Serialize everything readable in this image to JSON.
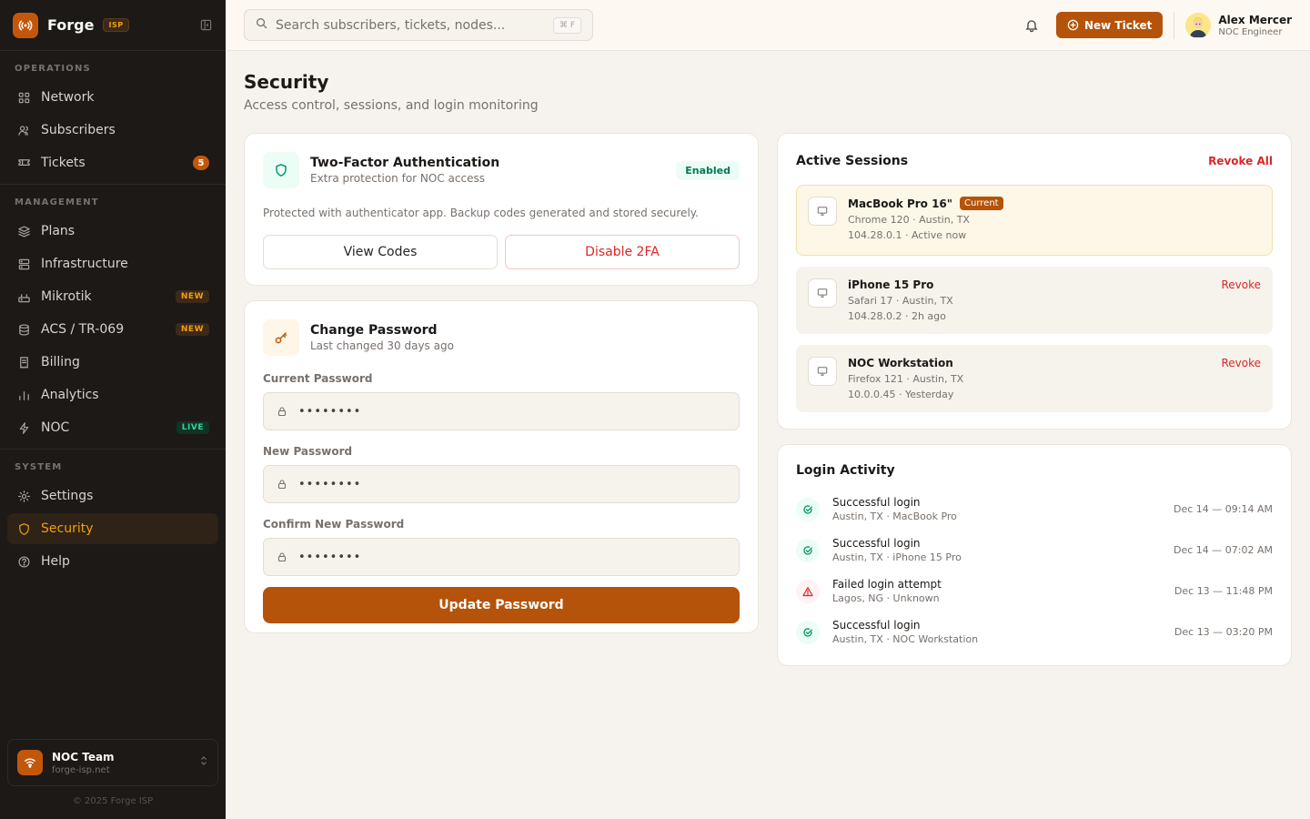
{
  "brand": {
    "name": "Forge",
    "tag": "ISP"
  },
  "sidebar": {
    "sections": [
      {
        "title": "OPERATIONS",
        "items": [
          {
            "label": "Network",
            "icon": "grid-icon"
          },
          {
            "label": "Subscribers",
            "icon": "users-icon"
          },
          {
            "label": "Tickets",
            "icon": "ticket-icon",
            "badge": "5"
          }
        ]
      },
      {
        "title": "MANAGEMENT",
        "items": [
          {
            "label": "Plans",
            "icon": "layers-icon"
          },
          {
            "label": "Infrastructure",
            "icon": "server-icon"
          },
          {
            "label": "Mikrotik",
            "icon": "router-icon",
            "badge": "NEW"
          },
          {
            "label": "ACS / TR-069",
            "icon": "database-icon",
            "badge": "NEW"
          },
          {
            "label": "Billing",
            "icon": "receipt-icon"
          },
          {
            "label": "Analytics",
            "icon": "bar-chart-icon"
          },
          {
            "label": "NOC",
            "icon": "bolt-icon",
            "badge": "LIVE"
          }
        ]
      },
      {
        "title": "SYSTEM",
        "items": [
          {
            "label": "Settings",
            "icon": "gear-icon"
          },
          {
            "label": "Security",
            "icon": "shield-icon",
            "active": true
          },
          {
            "label": "Help",
            "icon": "help-icon"
          }
        ]
      }
    ],
    "team": {
      "name": "NOC Team",
      "domain": "forge-isp.net"
    },
    "copyright": "© 2025 Forge ISP"
  },
  "topbar": {
    "search_placeholder": "Search subscribers, tickets, nodes...",
    "search_shortcut": "⌘ F",
    "new_ticket_label": "New Ticket",
    "user": {
      "name": "Alex Mercer",
      "role": "NOC Engineer"
    }
  },
  "page": {
    "title": "Security",
    "subtitle": "Access control, sessions, and login monitoring"
  },
  "twofa": {
    "title": "Two-Factor Authentication",
    "subtitle": "Extra protection for NOC access",
    "status": "Enabled",
    "description": "Protected with authenticator app. Backup codes generated and stored securely.",
    "view_codes_label": "View Codes",
    "disable_label": "Disable 2FA"
  },
  "password": {
    "title": "Change Password",
    "subtitle": "Last changed 30 days ago",
    "current_label": "Current Password",
    "current_value": "••••••••",
    "new_label": "New Password",
    "new_value": "••••••••",
    "confirm_label": "Confirm New Password",
    "confirm_value": "••••••••",
    "submit_label": "Update Password"
  },
  "sessions": {
    "title": "Active Sessions",
    "revoke_all_label": "Revoke All",
    "current_badge": "Current",
    "revoke_label": "Revoke",
    "items": [
      {
        "device": "MacBook Pro 16\"",
        "browser": "Chrome 120 · Austin, TX",
        "meta": "104.28.0.1 · Active now",
        "current": true
      },
      {
        "device": "iPhone 15 Pro",
        "browser": "Safari 17 · Austin, TX",
        "meta": "104.28.0.2 · 2h ago",
        "current": false
      },
      {
        "device": "NOC Workstation",
        "browser": "Firefox 121 · Austin, TX",
        "meta": "10.0.0.45 · Yesterday",
        "current": false
      }
    ]
  },
  "login_activity": {
    "title": "Login Activity",
    "items": [
      {
        "event": "Successful login",
        "meta": "Austin, TX · MacBook Pro",
        "time": "Dec 14 — 09:14 AM",
        "status": "ok"
      },
      {
        "event": "Successful login",
        "meta": "Austin, TX · iPhone 15 Pro",
        "time": "Dec 14 — 07:02 AM",
        "status": "ok"
      },
      {
        "event": "Failed login attempt",
        "meta": "Lagos, NG · Unknown",
        "time": "Dec 13 — 11:48 PM",
        "status": "fail"
      },
      {
        "event": "Successful login",
        "meta": "Austin, TX · NOC Workstation",
        "time": "Dec 13 — 03:20 PM",
        "status": "ok"
      }
    ]
  },
  "colors": {
    "accent": "#b45309",
    "sidebar_bg": "#1c1917",
    "success": "#059669",
    "danger": "#dc2626"
  }
}
